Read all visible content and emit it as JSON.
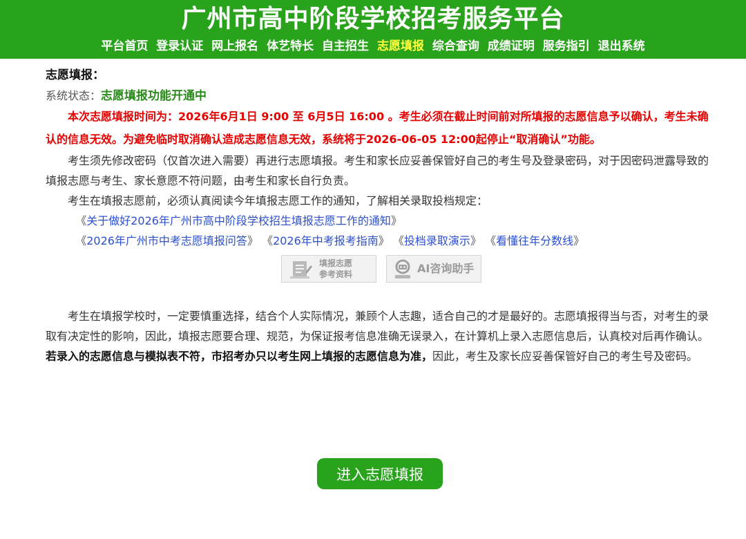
{
  "header": {
    "title": "广州市高中阶段学校招考服务平台",
    "nav": [
      {
        "label": "平台首页",
        "active": false
      },
      {
        "label": "登录认证",
        "active": false
      },
      {
        "label": "网上报名",
        "active": false
      },
      {
        "label": "体艺特长",
        "active": false
      },
      {
        "label": "自主招生",
        "active": false
      },
      {
        "label": "志愿填报",
        "active": true
      },
      {
        "label": "综合查询",
        "active": false
      },
      {
        "label": "成绩证明",
        "active": false
      },
      {
        "label": "服务指引",
        "active": false
      },
      {
        "label": "退出系统",
        "active": false
      }
    ]
  },
  "main": {
    "title": "志愿填报：",
    "status_label": "系统状态：",
    "status_value": "志愿填报功能开通中",
    "notice": "本次志愿填报时间为：2026年6月1日 9:00 至 6月5日 16:00 。考生必须在截止时间前对所填报的志愿信息予以确认，考生未确认的信息无效。为避免临时取消确认造成志愿信息无效，系统将于2026-06-05 12:00起停止“取消确认”功能。",
    "para1": "考生须先修改密码（仅首次进入需要）再进行志愿填报。考生和家长应妥善保管好自己的考生号及登录密码，对于因密码泄露导致的填报志愿与考生、家长意愿不符问题，由考生和家长自行负责。",
    "para2": "考生在填报志愿前，必须认真阅读今年填报志愿工作的通知，了解相关录取投档规定：",
    "link_main": "关于做好2026年广州市高中阶段学校招生填报志愿工作的通知",
    "links": [
      "2026年广州市中考志愿填报问答",
      "2026年中考报考指南",
      "投档录取演示",
      "看懂往年分数线"
    ],
    "quote_open": "《",
    "quote_close": "》",
    "ref_button": {
      "line1": "填报志愿",
      "line2": "参考资料"
    },
    "ai_button": "AI咨询助手",
    "para3_plain": "考生在填报学校时，一定要慎重选择，结合个人实际情况，兼顾个人志趣，适合自己的才是最好的。志愿填报得当与否，对考生的录取有决定性的影响，因此，填报志愿要合理、规范，为保证报考信息准确无误录入，在计算机上录入志愿信息后，认真校对后再作确认。",
    "para3_bold": "若录入的志愿信息与模拟表不符，市招考办只以考生网上填报的志愿信息为准，",
    "para3_tail": "因此，考生及家长应妥善保管好自己的考生号及密码。",
    "enter_button": "进入志愿填报"
  },
  "colors": {
    "brand_green": "#2aa31c",
    "nav_active": "#ffff3c",
    "warning_red": "#e60000",
    "status_green": "#2a8a1a",
    "link_blue": "#2b4fd1"
  }
}
